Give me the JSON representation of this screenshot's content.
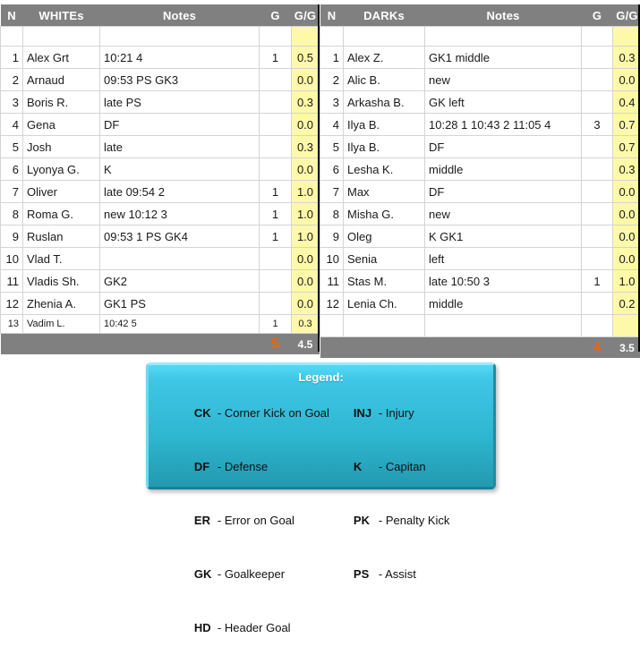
{
  "tables": [
    {
      "side": "left",
      "headers": [
        "N",
        "WHITEs",
        "Notes",
        "G",
        "G/G"
      ],
      "rows": [
        {
          "n": "1",
          "name": "Alex Grt",
          "notes": "10:21  4",
          "g": "1",
          "gg": "0.5"
        },
        {
          "n": "2",
          "name": "Arnaud",
          "notes": "09:53 PS  GK3",
          "g": "",
          "gg": "0.0"
        },
        {
          "n": "3",
          "name": "Boris R.",
          "notes": "late  PS",
          "g": "",
          "gg": "0.3"
        },
        {
          "n": "4",
          "name": "Gena",
          "notes": "DF",
          "g": "",
          "gg": "0.0"
        },
        {
          "n": "5",
          "name": "Josh",
          "notes": "late",
          "g": "",
          "gg": "0.3"
        },
        {
          "n": "6",
          "name": "Lyonya G.",
          "notes": "K",
          "g": "",
          "gg": "0.0"
        },
        {
          "n": "7",
          "name": "Oliver",
          "notes": "late  09:54 2",
          "g": "1",
          "gg": "1.0"
        },
        {
          "n": "8",
          "name": "Roma G.",
          "notes": "new 10:12 3",
          "g": "1",
          "gg": "1.0"
        },
        {
          "n": "9",
          "name": "Ruslan",
          "notes": "09:53 1  PS  GK4",
          "g": "1",
          "gg": "1.0"
        },
        {
          "n": "10",
          "name": "Vlad T.",
          "notes": "",
          "g": "",
          "gg": "0.0"
        },
        {
          "n": "11",
          "name": "Vladis Sh.",
          "notes": "GK2",
          "g": "",
          "gg": "0.0"
        },
        {
          "n": "12",
          "name": "Zhenia A.",
          "notes": "GK1  PS",
          "g": "",
          "gg": "0.0"
        },
        {
          "n": "13",
          "name": "Vadim L.",
          "notes": "10:42 5",
          "g": "1",
          "gg": "0.3"
        }
      ],
      "totals": {
        "g": "5",
        "gg": "4.5"
      }
    },
    {
      "side": "right",
      "headers": [
        "N",
        "DARKs",
        "Notes",
        "G",
        "G/G"
      ],
      "rows": [
        {
          "n": "1",
          "name": "Alex Z.",
          "notes": "GK1  middle",
          "g": "",
          "gg": "0.3"
        },
        {
          "n": "2",
          "name": "Alic B.",
          "notes": "new",
          "g": "",
          "gg": "0.0"
        },
        {
          "n": "3",
          "name": "Arkasha B.",
          "notes": "GK left",
          "g": "",
          "gg": "0.4"
        },
        {
          "n": "4",
          "name": "Ilya B.",
          "notes": "10:28 1  10:43 2  11:05 4",
          "g": "3",
          "gg": "0.7"
        },
        {
          "n": "5",
          "name": "Ilya B.",
          "notes": "DF",
          "g": "",
          "gg": "0.7"
        },
        {
          "n": "6",
          "name": "Lesha K.",
          "notes": "middle",
          "g": "",
          "gg": "0.3"
        },
        {
          "n": "7",
          "name": "Max",
          "notes": "DF",
          "g": "",
          "gg": "0.0"
        },
        {
          "n": "8",
          "name": "Misha G.",
          "notes": "new",
          "g": "",
          "gg": "0.0"
        },
        {
          "n": "9",
          "name": "Oleg",
          "notes": "K  GK1",
          "g": "",
          "gg": "0.0"
        },
        {
          "n": "10",
          "name": "Senia",
          "notes": "left",
          "g": "",
          "gg": "0.0"
        },
        {
          "n": "11",
          "name": "Stas M.",
          "notes": "late  10:50 3",
          "g": "1",
          "gg": "1.0"
        },
        {
          "n": "12",
          "name": "Lenia Ch.",
          "notes": "middle",
          "g": "",
          "gg": "0.2"
        }
      ],
      "totals": {
        "g": "4",
        "gg": "3.5"
      }
    }
  ],
  "legend": {
    "title": "Legend:",
    "left_column": [
      {
        "abbr": "CK",
        "desc": "- Corner Kick on Goal"
      },
      {
        "abbr": "DF",
        "desc": "- Defense"
      },
      {
        "abbr": "ER",
        "desc": "- Error on Goal"
      },
      {
        "abbr": "GK",
        "desc": "- Goalkeeper"
      },
      {
        "abbr": "HD",
        "desc": "- Header Goal"
      }
    ],
    "right_column": [
      {
        "abbr": "INJ",
        "desc": "- Injury"
      },
      {
        "abbr": "K",
        "desc": "- Capitan"
      },
      {
        "abbr": "PK",
        "desc": "- Penalty Kick"
      },
      {
        "abbr": "PS",
        "desc": "- Assist"
      }
    ]
  },
  "colors": {
    "header_gray": "#808080",
    "gg_highlight": "#fdf9a8",
    "total_accent": "#ec6608",
    "legend_top": "#55d9f5",
    "legend_bottom": "#2399b0",
    "grid_line": "#d4d4d4"
  }
}
